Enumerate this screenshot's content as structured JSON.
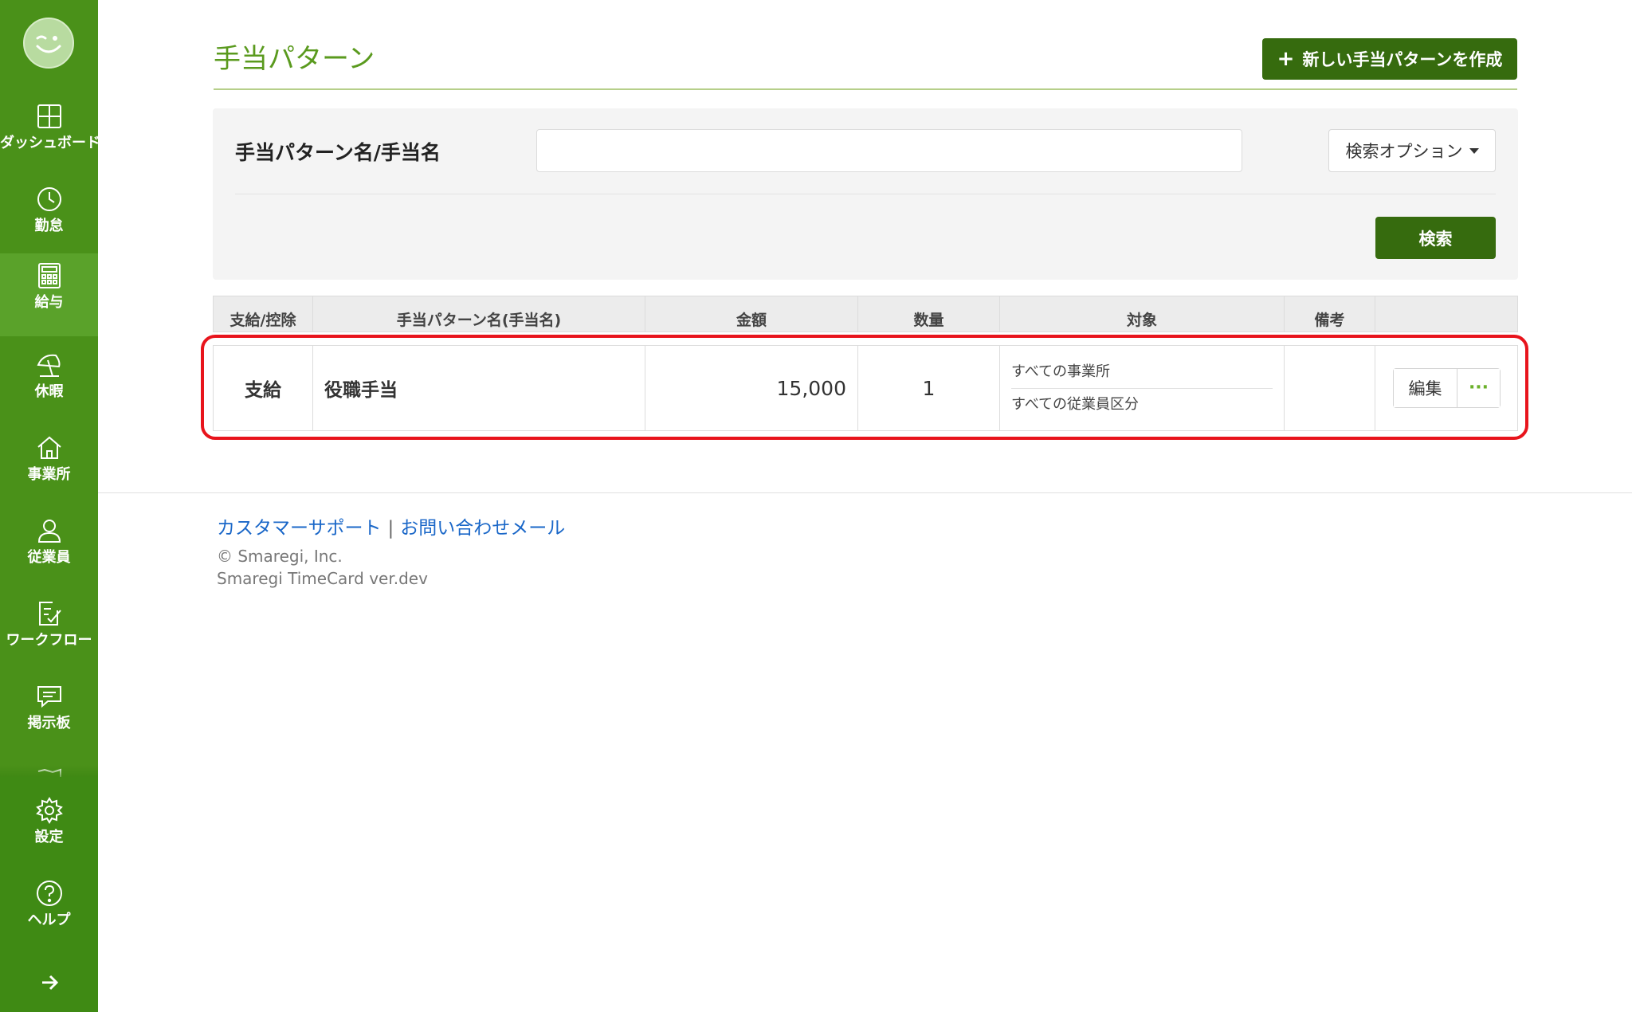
{
  "sidebar": {
    "items": [
      {
        "label": "ダッシュボード",
        "icon": "dashboard-grid-icon"
      },
      {
        "label": "勤怠",
        "icon": "clock-icon"
      },
      {
        "label": "給与",
        "icon": "calculator-icon"
      },
      {
        "label": "休暇",
        "icon": "beach-umbrella-icon"
      },
      {
        "label": "事業所",
        "icon": "house-icon"
      },
      {
        "label": "従業員",
        "icon": "person-icon"
      },
      {
        "label": "ワークフロー",
        "icon": "checklist-icon"
      },
      {
        "label": "掲示板",
        "icon": "chat-bubble-icon"
      }
    ],
    "active_item": "給与",
    "bottom_items": [
      {
        "label": "設定",
        "icon": "gear-icon"
      },
      {
        "label": "ヘルプ",
        "icon": "help-circle-icon"
      }
    ]
  },
  "header": {
    "title": "手当パターン",
    "create_button": "新しい手当パターンを作成"
  },
  "search": {
    "label": "手当パターン名/手当名",
    "input_value": "",
    "input_placeholder": "",
    "option_button": "検索オプション",
    "search_button": "検索"
  },
  "table": {
    "headers": [
      "支給/控除",
      "手当パターン名(手当名)",
      "金額",
      "数量",
      "対象",
      "備考",
      ""
    ],
    "rows": [
      {
        "type": "支給",
        "name": "役職手当",
        "amount": "15,000",
        "quantity": "1",
        "targets": [
          "すべての事業所",
          "すべての従業員区分"
        ],
        "note": "",
        "edit_button": "編集",
        "more_button": "···"
      }
    ]
  },
  "footer": {
    "support_link": "カスタマーサポート",
    "separator": "|",
    "contact_link": "お問い合わせメール",
    "copyright": "© Smaregi, Inc.",
    "version": "Smaregi TimeCard ver.dev"
  },
  "colors": {
    "sidebar": "#4a9119",
    "primary_button": "#366b0e",
    "title": "#5a9a1e",
    "link": "#1a67c8",
    "highlight": "#e8141c"
  }
}
